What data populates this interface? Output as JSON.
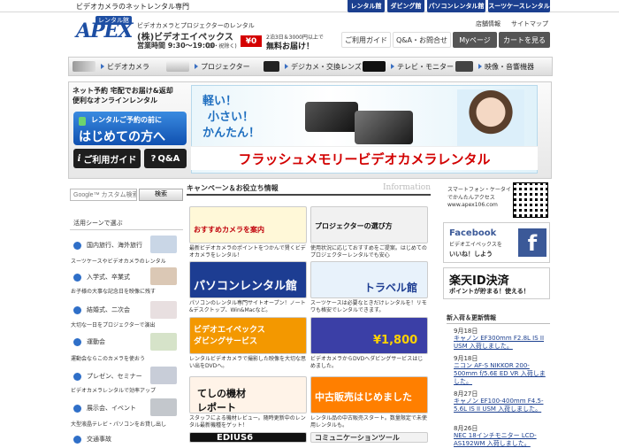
{
  "header": {
    "tagline": "ビデオカメラのネットレンタル専門",
    "top_tabs": [
      "レンタル館",
      "ダビング館",
      "パソコンレンタル館",
      "スーツケースレンタル"
    ],
    "logo_rental": "レンタル館",
    "logo_text": "APEX",
    "shop_sub": "ビデオカメラとプロジェクターのレンタル",
    "company": "(株)ビデオエイペックス",
    "hours": "営業時間 9:30～19:00",
    "hours_note": "(日・祝除く)",
    "free_badge": "¥0",
    "free_small": "2泊3日＆3000円以上で",
    "free_main": "無料お届け！",
    "links": [
      "店舗情報",
      "サイトマップ"
    ],
    "nav": [
      "ご利用ガイド",
      "Q&A・お問合せ",
      "Myページ",
      "カートを見る"
    ]
  },
  "categories": [
    "ビデオカメラ",
    "プロジェクター",
    "デジカメ・交換レンズ",
    "テレビ・モニター",
    "映像・音響機器"
  ],
  "hero": {
    "lines": [
      "ネット予約 宅配でお届け&返却",
      "便利なオンラインレンタル"
    ],
    "first_small": "レンタルご予約の前に",
    "first_main": "はじめての方へ",
    "guide": "ご利用ガイド",
    "qa": "Q&A",
    "banner_a": "軽い！",
    "banner_b": "小さい！",
    "banner_c": "かんたん！",
    "banner_title": "フラッシュメモリービデオカメラレンタル"
  },
  "search": {
    "placeholder": "Google™ カスタム検索",
    "button": "検索"
  },
  "scenes": {
    "heading": "活用シーンで選ぶ",
    "items": [
      {
        "label": "国内旅行、海外旅行",
        "sub": "スーツケースやビデオカメラのレンタル"
      },
      {
        "label": "入学式、卒業式",
        "sub": "お子様の大事な記念日を映像に残す"
      },
      {
        "label": "結婚式、二次会",
        "sub": "大切な一日をプロジェクターで演出"
      },
      {
        "label": "運動会",
        "sub": "運動会ならこのカメラを使おう"
      },
      {
        "label": "プレゼン、セミナー",
        "sub": "ビデオカメラレンタルで効率アップ"
      },
      {
        "label": "展示会、イベント",
        "sub": "大型液晶テレビ・パソコンをお貸し出し"
      },
      {
        "label": "交通事故",
        "sub": ""
      }
    ]
  },
  "campaign": {
    "heading": "キャンペーン＆お役立ち情報",
    "heading_en": "Information",
    "cards": [
      {
        "img": "おすすめカメラを案内",
        "txt": "最新ビデオカメラのポイントをつかんで賢くビデオカメラをレンタル！"
      },
      {
        "img": "プロジェクターの選び方",
        "txt": "使用状況に応じておすすめをご提案。はじめてのプロジェクターレンタルでも安心"
      },
      {
        "img": "パソコンレンタル館",
        "txt": "パソコンのレンタル専門サイトオープン！ノート&デスクトップ、Win&Macなど。"
      },
      {
        "img": "トラベル館",
        "txt": "スーツケースは必要なときだけレンタルを！リモワも格安でレンタルできます。"
      },
      {
        "img": "ビデオエイペックス ダビングサービス",
        "txt": "レンタルビデオカメラで撮影した映像を大切な思い出をDVDへ。"
      },
      {
        "img": "¥1,800",
        "txt": "ビデオカメラからDVDへダビングサービスはじめました。"
      },
      {
        "img": "てしの機材レポート",
        "txt": "スタッフによる機材レビュー。随時更新中のレンタル最新機種をゲット！"
      },
      {
        "img": "中古販売はじめました",
        "txt": "レンタル品の中古販売スタート。数量限定で未使用レンタルも。"
      },
      {
        "img": "EDIUS6",
        "txt": ""
      },
      {
        "img": "コミュニケーションツール",
        "txt": ""
      }
    ]
  },
  "right": {
    "mobile": "スマートフォン・ケータイでかんたんアクセス",
    "url": "www.apex106.com",
    "fb": "Facebook",
    "fb_sub": "ビデオエイペックスを",
    "fb_like": "いいね！しよう",
    "rakuten": "楽天ID決済",
    "rakuten_sub": "ポイントが貯まる！使える！",
    "news_heading": "新入荷＆更新情報",
    "news": [
      {
        "date": "9月18日",
        "text": "キャノン EF300mm F2.8L IS II USM 入荷しました。"
      },
      {
        "date": "9月18日",
        "text": "ニコン AF-S NIKKOR 200-500mm f/5.6E ED VR 入荷しました。"
      },
      {
        "date": "8月27日",
        "text": "キャノン EF100-400mm F4.5-5.6L IS II USM 入荷しました。"
      },
      {
        "date": "8月26日",
        "text": "NEC 18インチモニター LCD-AS192WM 入荷しました。"
      }
    ]
  },
  "colors": {
    "navy": "#1b3f8f",
    "red": "#d40000",
    "blue": "#2f6fc8"
  }
}
